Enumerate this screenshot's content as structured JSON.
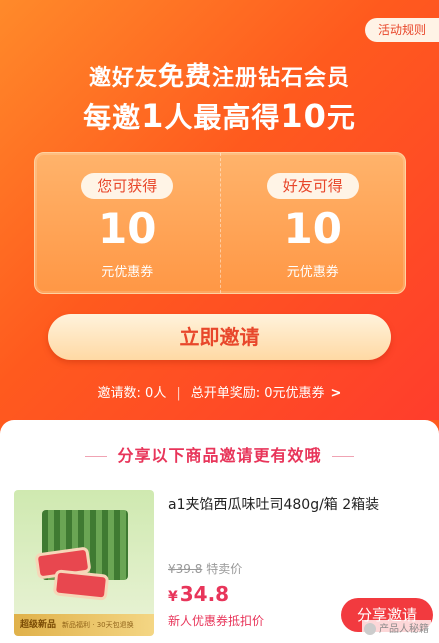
{
  "header": {
    "rules_label": "活动规则",
    "headline_prefix": "邀好友",
    "headline_free": "免费",
    "headline_suffix": "注册钻石会员",
    "reward_prefix": "每邀",
    "reward_num": "1",
    "reward_mid": "人最高得",
    "reward_amount": "10",
    "reward_suffix": "元"
  },
  "rewards": [
    {
      "label": "您可获得",
      "amount": "10",
      "unit": "元优惠券"
    },
    {
      "label": "好友可得",
      "amount": "10",
      "unit": "元优惠券"
    }
  ],
  "invite_button": "立即邀请",
  "stats": {
    "invites": "邀请数: 0人",
    "total": "总开单奖励: 0元优惠券",
    "chevron": ">"
  },
  "product_section": {
    "title": "分享以下商品邀请更有效哦",
    "product": {
      "name": "a1夹馅西瓜味吐司480g/箱 2箱装",
      "badge_tag": "超级新品",
      "badge_sub": "新品福利 · 30天包退换",
      "original_price": "¥39.8",
      "original_label": "特卖价",
      "currency": "¥",
      "price": "34.8",
      "price_note": "新人优惠券抵扣价",
      "share_label": "分享邀请"
    }
  },
  "watermark": "产品人秘籍",
  "colors": {
    "accent": "#e8355a",
    "hero_start": "#ff8a2a",
    "hero_end": "#ff3d2c"
  }
}
